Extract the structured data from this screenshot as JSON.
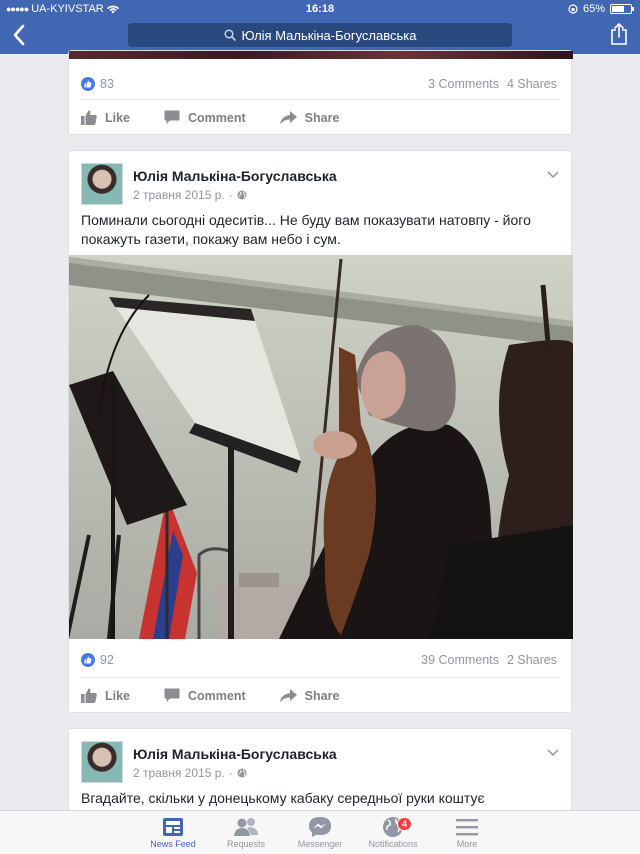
{
  "status_bar": {
    "carrier": "UA-KYIVSTAR",
    "time": "16:18",
    "battery_percent": "65%",
    "battery_level": 0.65
  },
  "nav": {
    "search_text": "Юлія Малькіна-Богуславська"
  },
  "posts": [
    {
      "likes": "83",
      "comments": "3 Comments",
      "shares": "4 Shares"
    },
    {
      "author": "Юлія Малькіна-Богуславська",
      "date": "2 травня 2015 р.",
      "text": "Поминали сьогодні одеситів... Не буду вам показувати натовпу - його покажуть газети, покажу вам небо і сум.",
      "likes": "92",
      "comments": "39 Comments",
      "shares": "2 Shares"
    },
    {
      "author": "Юлія Малькіна-Богуславська",
      "date": "2 травня 2015 р.",
      "text": "Вгадайте, скільки у донецькому кабаку середньої руки коштує"
    }
  ],
  "actions": {
    "like": "Like",
    "comment": "Comment",
    "share": "Share"
  },
  "tabbar": {
    "items": [
      {
        "label": "News Feed",
        "icon": "news-feed-icon",
        "active": true
      },
      {
        "label": "Requests",
        "icon": "friend-requests-icon"
      },
      {
        "label": "Messenger",
        "icon": "messenger-icon"
      },
      {
        "label": "Notifications",
        "icon": "globe-icon",
        "badge": "4"
      },
      {
        "label": "More",
        "icon": "menu-icon"
      }
    ]
  },
  "colors": {
    "brand": "#4267b2",
    "background": "#e9ebee",
    "badge": "#fa3e3e"
  }
}
